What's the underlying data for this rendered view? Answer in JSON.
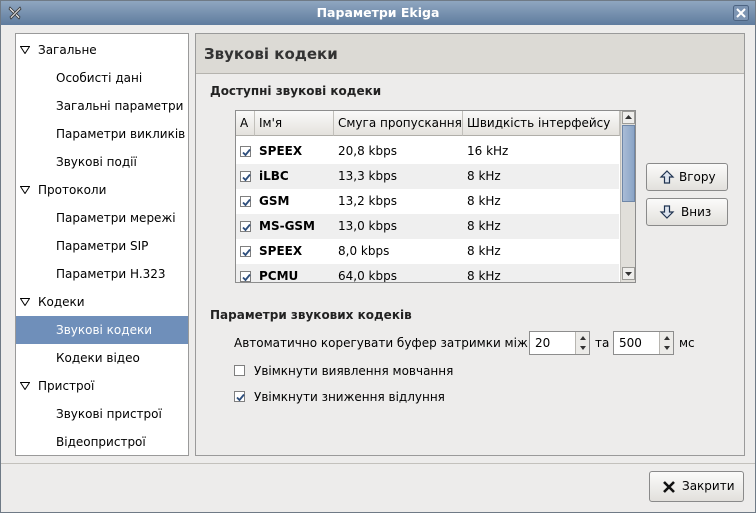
{
  "window": {
    "title": "Параметри Ekiga"
  },
  "sidebar": {
    "items": [
      {
        "label": "Загальне",
        "level": 0,
        "expanded": true
      },
      {
        "label": "Особисті дані",
        "level": 1
      },
      {
        "label": "Загальні параметри",
        "level": 1
      },
      {
        "label": "Параметри викликів",
        "level": 1
      },
      {
        "label": "Звукові події",
        "level": 1
      },
      {
        "label": "Протоколи",
        "level": 0,
        "expanded": true
      },
      {
        "label": "Параметри мережі",
        "level": 1
      },
      {
        "label": "Параметри SIP",
        "level": 1
      },
      {
        "label": "Параметри H.323",
        "level": 1
      },
      {
        "label": "Кодеки",
        "level": 0,
        "expanded": true
      },
      {
        "label": "Звукові кодеки",
        "level": 1,
        "selected": true
      },
      {
        "label": "Кодеки відео",
        "level": 1
      },
      {
        "label": "Пристрої",
        "level": 0,
        "expanded": true
      },
      {
        "label": "Звукові пристрої",
        "level": 1
      },
      {
        "label": "Відеопристрої",
        "level": 1
      }
    ]
  },
  "content": {
    "title": "Звукові кодеки",
    "available_title": "Доступні звукові кодеки",
    "table": {
      "columns": [
        "A",
        "Ім'я",
        "Смуга пропускання",
        "Швидкість інтерфейсу"
      ],
      "rows": [
        {
          "enabled": true,
          "name": "SPEEX",
          "bandwidth": "20,8 kbps",
          "rate": "16 kHz"
        },
        {
          "enabled": true,
          "name": "iLBC",
          "bandwidth": "13,3 kbps",
          "rate": "8 kHz"
        },
        {
          "enabled": true,
          "name": "GSM",
          "bandwidth": "13,2 kbps",
          "rate": "8 kHz"
        },
        {
          "enabled": true,
          "name": "MS-GSM",
          "bandwidth": "13,0 kbps",
          "rate": "8 kHz"
        },
        {
          "enabled": true,
          "name": "SPEEX",
          "bandwidth": "8,0 kbps",
          "rate": "8 kHz"
        },
        {
          "enabled": true,
          "name": "PCMU",
          "bandwidth": "64,0 kbps",
          "rate": "8 kHz"
        }
      ]
    },
    "up_button": "Вгору",
    "down_button": "Вниз",
    "params_title": "Параметри звукових кодеків",
    "jitter_label": "Автоматично корегувати буфер затримки між",
    "jitter_min": "20",
    "jitter_and": "та",
    "jitter_max": "500",
    "jitter_unit": "мс",
    "silence_label": "Увімкнути виявлення мовчання",
    "silence_checked": false,
    "echo_label": "Увімкнути зниження відлуння",
    "echo_checked": true
  },
  "footer": {
    "close_button": "Закрити"
  }
}
